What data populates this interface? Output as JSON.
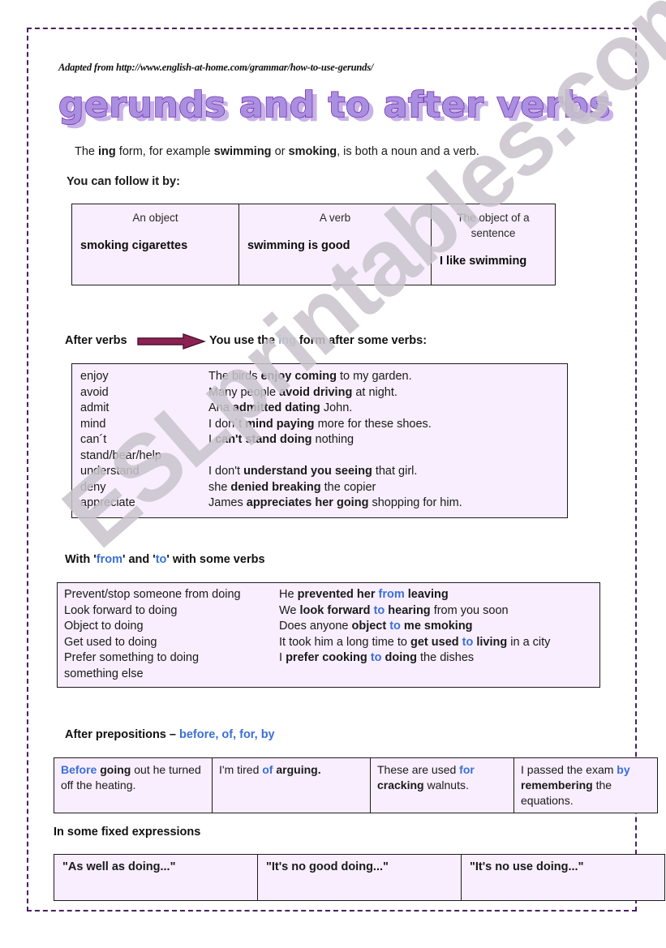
{
  "source_credit": "Adapted from http://www.english-at-home.com/grammar/how-to-use-gerunds/",
  "title": "gerunds and to after verbs",
  "watermark": "ESLprintables.com",
  "intro": {
    "p1_a": "The ",
    "p1_ing": "ing",
    "p1_b": " form, for example ",
    "p1_sw": "swimming",
    "p1_c": " or ",
    "p1_sm": "smoking",
    "p1_d": ", is both a noun and a verb.",
    "lead": "You can follow it by:"
  },
  "follow_table": {
    "columns": [
      {
        "header": "An object",
        "example": "smoking cigarettes"
      },
      {
        "header": "A verb",
        "example": "swimming is good"
      },
      {
        "header": "The object of a sentence",
        "example": "I like swimming"
      }
    ]
  },
  "after_verbs": {
    "label": "After verbs",
    "arrow_icon": "right-arrow-icon",
    "text_a": "You use the ",
    "text_ing": "ing",
    "text_b": " form after some verbs:",
    "rows": [
      {
        "verb": "enjoy",
        "pre": "The birds ",
        "bold": "enjoy coming",
        "post": " to my garden."
      },
      {
        "verb": "avoid",
        "pre": "Many people ",
        "bold": "avoid driving",
        "post": " at night."
      },
      {
        "verb": "admit",
        "pre": "Ana ",
        "bold": "admitted dating",
        "post": " John."
      },
      {
        "verb": "mind",
        "pre": "I don´t ",
        "bold": "mind paying",
        "post": " more for these shoes."
      },
      {
        "verb": "can´t",
        "pre": "I ",
        "bold": "can't stand doing",
        "post": " nothing"
      },
      {
        "verb": "stand/bear/help",
        "pre": "",
        "bold": "",
        "post": ""
      },
      {
        "verb": "understand",
        "pre": "I don't ",
        "bold": "understand you seeing",
        "post": " that girl."
      },
      {
        "verb": "deny",
        "pre": "she ",
        "bold": "denied breaking",
        "post": " the copier"
      },
      {
        "verb": "appreciate",
        "pre": "James ",
        "bold": "appreciates her going",
        "post": " shopping for him."
      }
    ]
  },
  "from_to": {
    "heading_a": "With '",
    "heading_from": "from",
    "heading_b": "' and '",
    "heading_to": "to",
    "heading_c": "' with some verbs",
    "rows": [
      {
        "pattern": "Prevent/stop someone from doing",
        "parts": [
          {
            "t": "He ",
            "s": "plain"
          },
          {
            "t": "prevented her ",
            "s": "bold"
          },
          {
            "t": "from",
            "s": "blue-bold"
          },
          {
            "t": " leaving",
            "s": "bold"
          }
        ]
      },
      {
        "pattern": "Look forward to doing",
        "parts": [
          {
            "t": "We ",
            "s": "plain"
          },
          {
            "t": "look forward ",
            "s": "bold"
          },
          {
            "t": "to",
            "s": "blue-bold"
          },
          {
            "t": " hearing",
            "s": "bold"
          },
          {
            "t": " from you soon",
            "s": "plain"
          }
        ]
      },
      {
        "pattern": "Object to doing",
        "parts": [
          {
            "t": "Does anyone ",
            "s": "plain"
          },
          {
            "t": "object ",
            "s": "bold"
          },
          {
            "t": "to",
            "s": "blue-bold"
          },
          {
            "t": " me smoking",
            "s": "bold"
          }
        ]
      },
      {
        "pattern": "Get used to doing",
        "parts": [
          {
            "t": "It took him a long time to ",
            "s": "plain"
          },
          {
            "t": "get used ",
            "s": "bold"
          },
          {
            "t": "to",
            "s": "blue-bold"
          },
          {
            "t": " living",
            "s": "bold"
          },
          {
            "t": " in a city",
            "s": "plain"
          }
        ]
      },
      {
        "pattern": "Prefer something to doing",
        "parts": [
          {
            "t": "I ",
            "s": "plain"
          },
          {
            "t": "prefer cooking ",
            "s": "bold"
          },
          {
            "t": "to",
            "s": "blue-bold"
          },
          {
            "t": " doing",
            "s": "bold"
          },
          {
            "t": " the dishes",
            "s": "plain"
          }
        ]
      },
      {
        "pattern": "something else",
        "parts": []
      }
    ]
  },
  "prepositions": {
    "heading_a": "After prepositions – ",
    "heading_list": "before, of, for, by",
    "cells": [
      [
        {
          "t": "Before",
          "s": "blue-bold"
        },
        {
          "t": " going",
          "s": "bold"
        },
        {
          "t": " out he turned off the heating.",
          "s": "plain"
        }
      ],
      [
        {
          "t": "I'm tired ",
          "s": "plain"
        },
        {
          "t": "of",
          "s": "blue-bold"
        },
        {
          "t": " arguing.",
          "s": "bold"
        }
      ],
      [
        {
          "t": "These are used ",
          "s": "plain"
        },
        {
          "t": "for",
          "s": "blue-bold"
        },
        {
          "t": " cracking",
          "s": "bold"
        },
        {
          "t": " walnuts.",
          "s": "plain"
        }
      ],
      [
        {
          "t": "I passed the exam ",
          "s": "plain"
        },
        {
          "t": "by",
          "s": "blue-bold"
        },
        {
          "t": " remembering",
          "s": "bold"
        },
        {
          "t": " the equations.",
          "s": "plain"
        }
      ]
    ]
  },
  "fixed": {
    "heading": "In some fixed expressions",
    "cells": [
      "\"As well as doing...\"",
      "\"It's no good doing...\"",
      "\"It's no use doing...\""
    ]
  },
  "colors": {
    "border": "#4a2060",
    "table_bg": "#f8eefd",
    "arrow": "#8b2252",
    "accent_blue": "#3a6fd8",
    "title_fill": "#a98fe0",
    "title_stroke": "#7a2fb0",
    "title_shadow": "#c8b4e8",
    "watermark": "#c9c4cc"
  }
}
